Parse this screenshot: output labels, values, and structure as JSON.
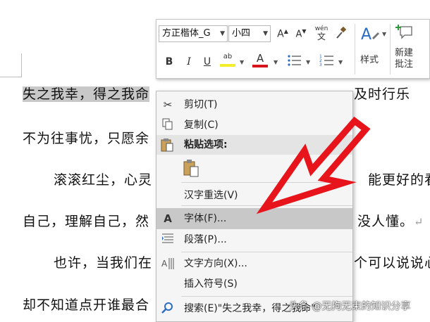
{
  "document": {
    "lines": [
      {
        "sel": "失之我幸，得之我命",
        "rest": "  ，及时行乐"
      },
      {
        "sel": "",
        "rest": "不为往事忧，只愿余"
      },
      {
        "sel": "",
        "rest": "    滚滚红尘，心灵                  能更好的看"
      },
      {
        "sel": "",
        "rest": "自己，理解自己，然                  没人懂。"
      },
      {
        "sel": "",
        "rest": "    也许，当我们在                  个可以说说心"
      },
      {
        "sel": "",
        "rest": "却不知道点开谁最合"
      }
    ],
    "para_mark": "↵"
  },
  "toolbar": {
    "font_name": "方正楷体_G",
    "font_size": "小四",
    "grow_font": "A",
    "shrink_font": "A",
    "phonetic_top": "wén",
    "phonetic_bottom": "文",
    "bold": "B",
    "italic": "I",
    "underline": "U",
    "highlight_glyph": "ab",
    "font_color_glyph": "A",
    "styles_label": "样式",
    "new_comment_label_1": "新建",
    "new_comment_label_2": "批注",
    "colors": {
      "highlight": "#f3ee2c",
      "font_color": "#d6141c",
      "accent": "#2b6cc4"
    }
  },
  "menu": {
    "cut": "剪切(T)",
    "copy": "复制(C)",
    "paste_options": "粘贴选项:",
    "reconvert": "汉字重选(V)",
    "font": "字体(F)...",
    "paragraph": "段落(P)...",
    "text_direction": "文字方向(X)...",
    "insert_symbol": "插入符号(S)",
    "search": "搜索(E)\"失之我幸，得之我命\""
  },
  "annotation": {
    "arrow_color": "#e8141c"
  },
  "watermark": "头条 @无拘无束的知识分享"
}
